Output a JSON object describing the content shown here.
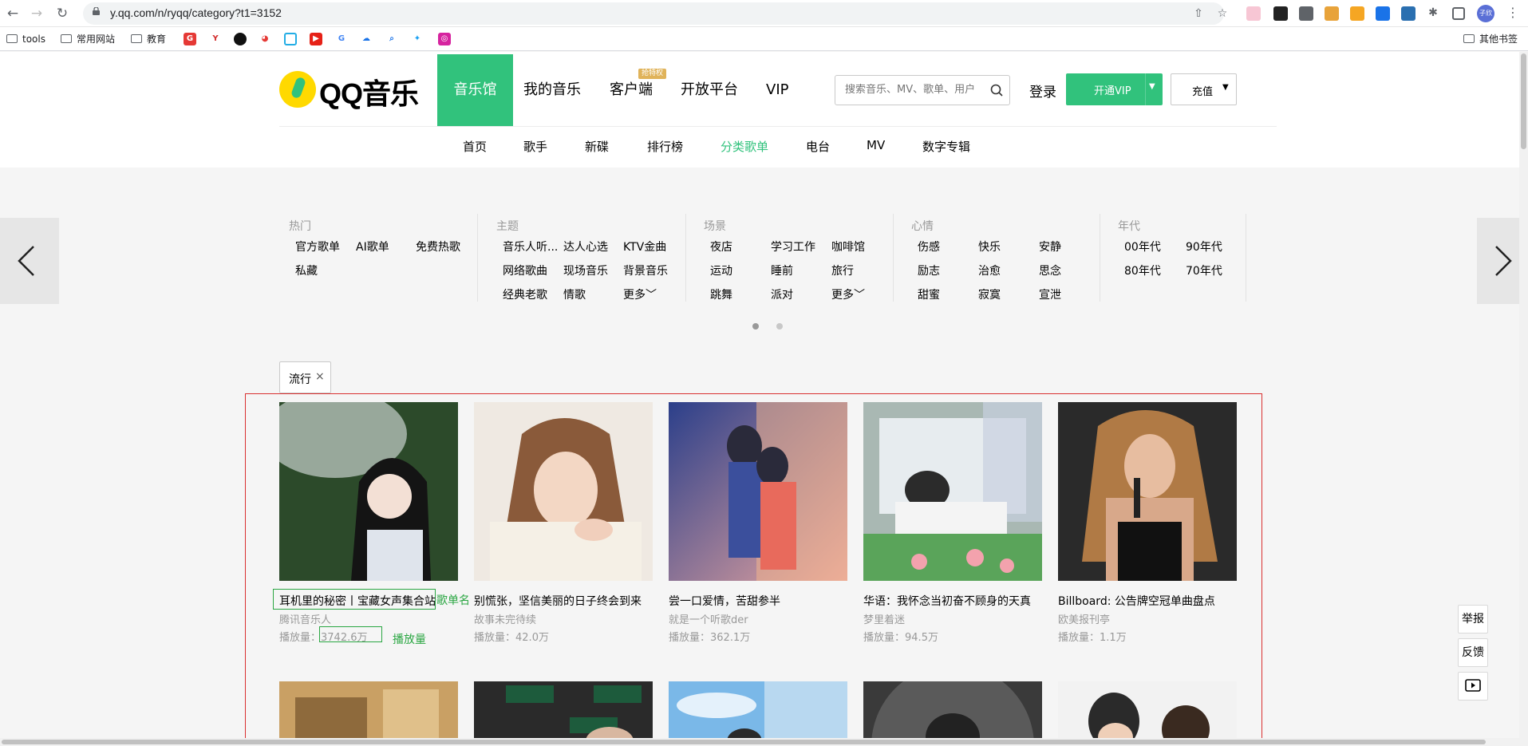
{
  "browser": {
    "url": "y.qq.com/n/ryqq/category?t1=3152",
    "profile": "子欣",
    "bookmarks": [
      "tools",
      "常用网站",
      "教育"
    ],
    "other_bookmarks": "其他书签"
  },
  "header": {
    "logo": "QQ音乐",
    "nav": [
      "音乐馆",
      "我的音乐",
      "客户端",
      "开放平台",
      "VIP"
    ],
    "client_badge": "抢特权",
    "search_placeholder": "搜索音乐、MV、歌单、用户",
    "login": "登录",
    "vip_button": "开通VIP",
    "charge_button": "充值"
  },
  "sub_nav": [
    "首页",
    "歌手",
    "新碟",
    "排行榜",
    "分类歌单",
    "电台",
    "MV",
    "数字专辑"
  ],
  "categories": [
    {
      "title": "热门",
      "items": [
        "官方歌单",
        "AI歌单",
        "免费热歌",
        "私藏"
      ]
    },
    {
      "title": "主题",
      "items": [
        "音乐人听...",
        "达人心选",
        "KTV金曲",
        "网络歌曲",
        "现场音乐",
        "背景音乐",
        "经典老歌",
        "情歌",
        "更多"
      ]
    },
    {
      "title": "场景",
      "items": [
        "夜店",
        "学习工作",
        "咖啡馆",
        "运动",
        "睡前",
        "旅行",
        "跳舞",
        "派对",
        "更多"
      ]
    },
    {
      "title": "心情",
      "items": [
        "伤感",
        "快乐",
        "安静",
        "励志",
        "治愈",
        "思念",
        "甜蜜",
        "寂寞",
        "宣泄"
      ]
    },
    {
      "title": "年代",
      "items": [
        "00年代",
        "90年代",
        "80年代",
        "70年代"
      ]
    }
  ],
  "active_tag": "流行",
  "playlists": [
    {
      "title": "耳机里的秘密丨宝藏女声集合站",
      "author": "腾讯音乐人",
      "plays_label": "播放量：",
      "plays": "3742.6万"
    },
    {
      "title": "别慌张，坚信美丽的日子终会到来",
      "author": "故事未完待续",
      "plays_label": "播放量：",
      "plays": "42.0万"
    },
    {
      "title": "尝一口爱情，苦甜参半",
      "author": "就是一个听歌der",
      "plays_label": "播放量：",
      "plays": "362.1万"
    },
    {
      "title": "华语：我怀念当初奋不顾身的天真",
      "author": "梦里着迷",
      "plays_label": "播放量：",
      "plays": "94.5万"
    },
    {
      "title": "Billboard: 公告牌空冠单曲盘点",
      "author": "欧美报刊亭",
      "plays_label": "播放量：",
      "plays": "1.1万"
    }
  ],
  "annotations": {
    "name": "歌单名",
    "plays": "播放量"
  },
  "side_tools": [
    "举报",
    "反馈"
  ]
}
